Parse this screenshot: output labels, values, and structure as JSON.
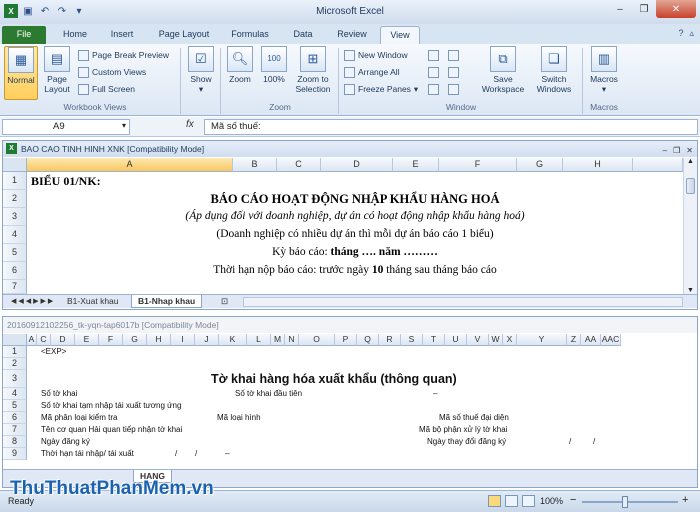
{
  "app_title": "Microsoft Excel",
  "tabs": [
    "File",
    "Home",
    "Insert",
    "Page Layout",
    "Formulas",
    "Data",
    "Review",
    "View"
  ],
  "ribbon": {
    "workbook_views": {
      "label": "Workbook Views",
      "normal": "Normal",
      "page_layout": "Page Layout",
      "page_break": "Page Break Preview",
      "custom_views": "Custom Views",
      "full_screen": "Full Screen"
    },
    "show": {
      "label": "Show"
    },
    "zoom": {
      "label": "Zoom",
      "zoom": "Zoom",
      "p100": "100%",
      "to_sel": "Zoom to Selection"
    },
    "window": {
      "label": "Window",
      "new_window": "New Window",
      "arrange_all": "Arrange All",
      "freeze": "Freeze Panes",
      "save_ws": "Save Workspace",
      "switch": "Switch Windows"
    },
    "macros": {
      "label": "Macros",
      "macros": "Macros"
    }
  },
  "formula_bar": {
    "name_box": "A9",
    "fx": "fx",
    "formula": "Mã số thuế:"
  },
  "win1": {
    "title": "BAO CAO TINH HINH XNK  [Compatibility Mode]",
    "columns": [
      "A",
      "B",
      "C",
      "D",
      "E",
      "F",
      "G",
      "H"
    ],
    "rows": [
      "1",
      "2",
      "3",
      "4",
      "5",
      "6",
      "7"
    ],
    "r1": "BIỂU 01/NK:",
    "r2": "BÁO CÁO HOẠT ĐỘNG NHẬP KHẨU HÀNG HOÁ",
    "r3": "(Áp dụng đối với doanh nghiệp, dự án có hoạt động nhập khẩu hàng hoá)",
    "r4": "(Doanh nghiệp có nhiều dự án thì mỗi dự án báo cáo 1 biểu)",
    "r5a": "Kỳ báo cáo: ",
    "r5b": "tháng …. năm ………",
    "r6a": "Thời hạn nộp báo cáo: trước ngày ",
    "r6b": "10",
    "r6c": " tháng sau tháng báo cáo",
    "sheet_tabs": [
      "B1-Xuat khau",
      "B1-Nhap khau"
    ]
  },
  "win2": {
    "title": "20160912102256_tk-yqn-tap6017b  [Compatibility Mode]",
    "columns": [
      "A",
      "C",
      "D",
      "E",
      "F",
      "G",
      "H",
      "I",
      "J",
      "K",
      "L",
      "M",
      "N",
      "O",
      "P",
      "Q",
      "R",
      "S",
      "T",
      "U",
      "V",
      "W",
      "X",
      "Y",
      "Z",
      "AA",
      "AAC"
    ],
    "rows": [
      "1",
      "2",
      "3",
      "4",
      "5",
      "6",
      "7",
      "8",
      "9"
    ],
    "exp": "<EXP>",
    "heading": "Tờ khai hàng hóa xuất khẩu (thông quan)",
    "so_to_khai": "Số tờ khai",
    "so_dau_tien": "Số tờ khai đầu tiên",
    "dash": "–",
    "tam_nhap": "Số tờ khai tạm nhập tái xuất tương ứng",
    "ma_phan_loai": "Mã phân loại kiểm tra",
    "ma_loai_hinh": "Mã loại hình",
    "ma_so_thue_dd": "Mã số thuế đại diện",
    "ten_co_quan": "Tên cơ quan Hải quan tiếp nhận tờ khai",
    "ma_bo_phan": "Mã bộ phận xử lý tờ khai",
    "ngay_dang_ky": "Ngày đăng ký",
    "slash": "/",
    "ngay_thay_doi": "Ngày thay đổi đăng ký",
    "thoi_han": "Thời hạn tái nhập/ tái xuất",
    "sheet_tab": "HANG"
  },
  "status": {
    "ready": "Ready",
    "zoom": "100%",
    "minus": "−",
    "plus": "+"
  },
  "watermark": "ThuThuatPhanMem.vn"
}
